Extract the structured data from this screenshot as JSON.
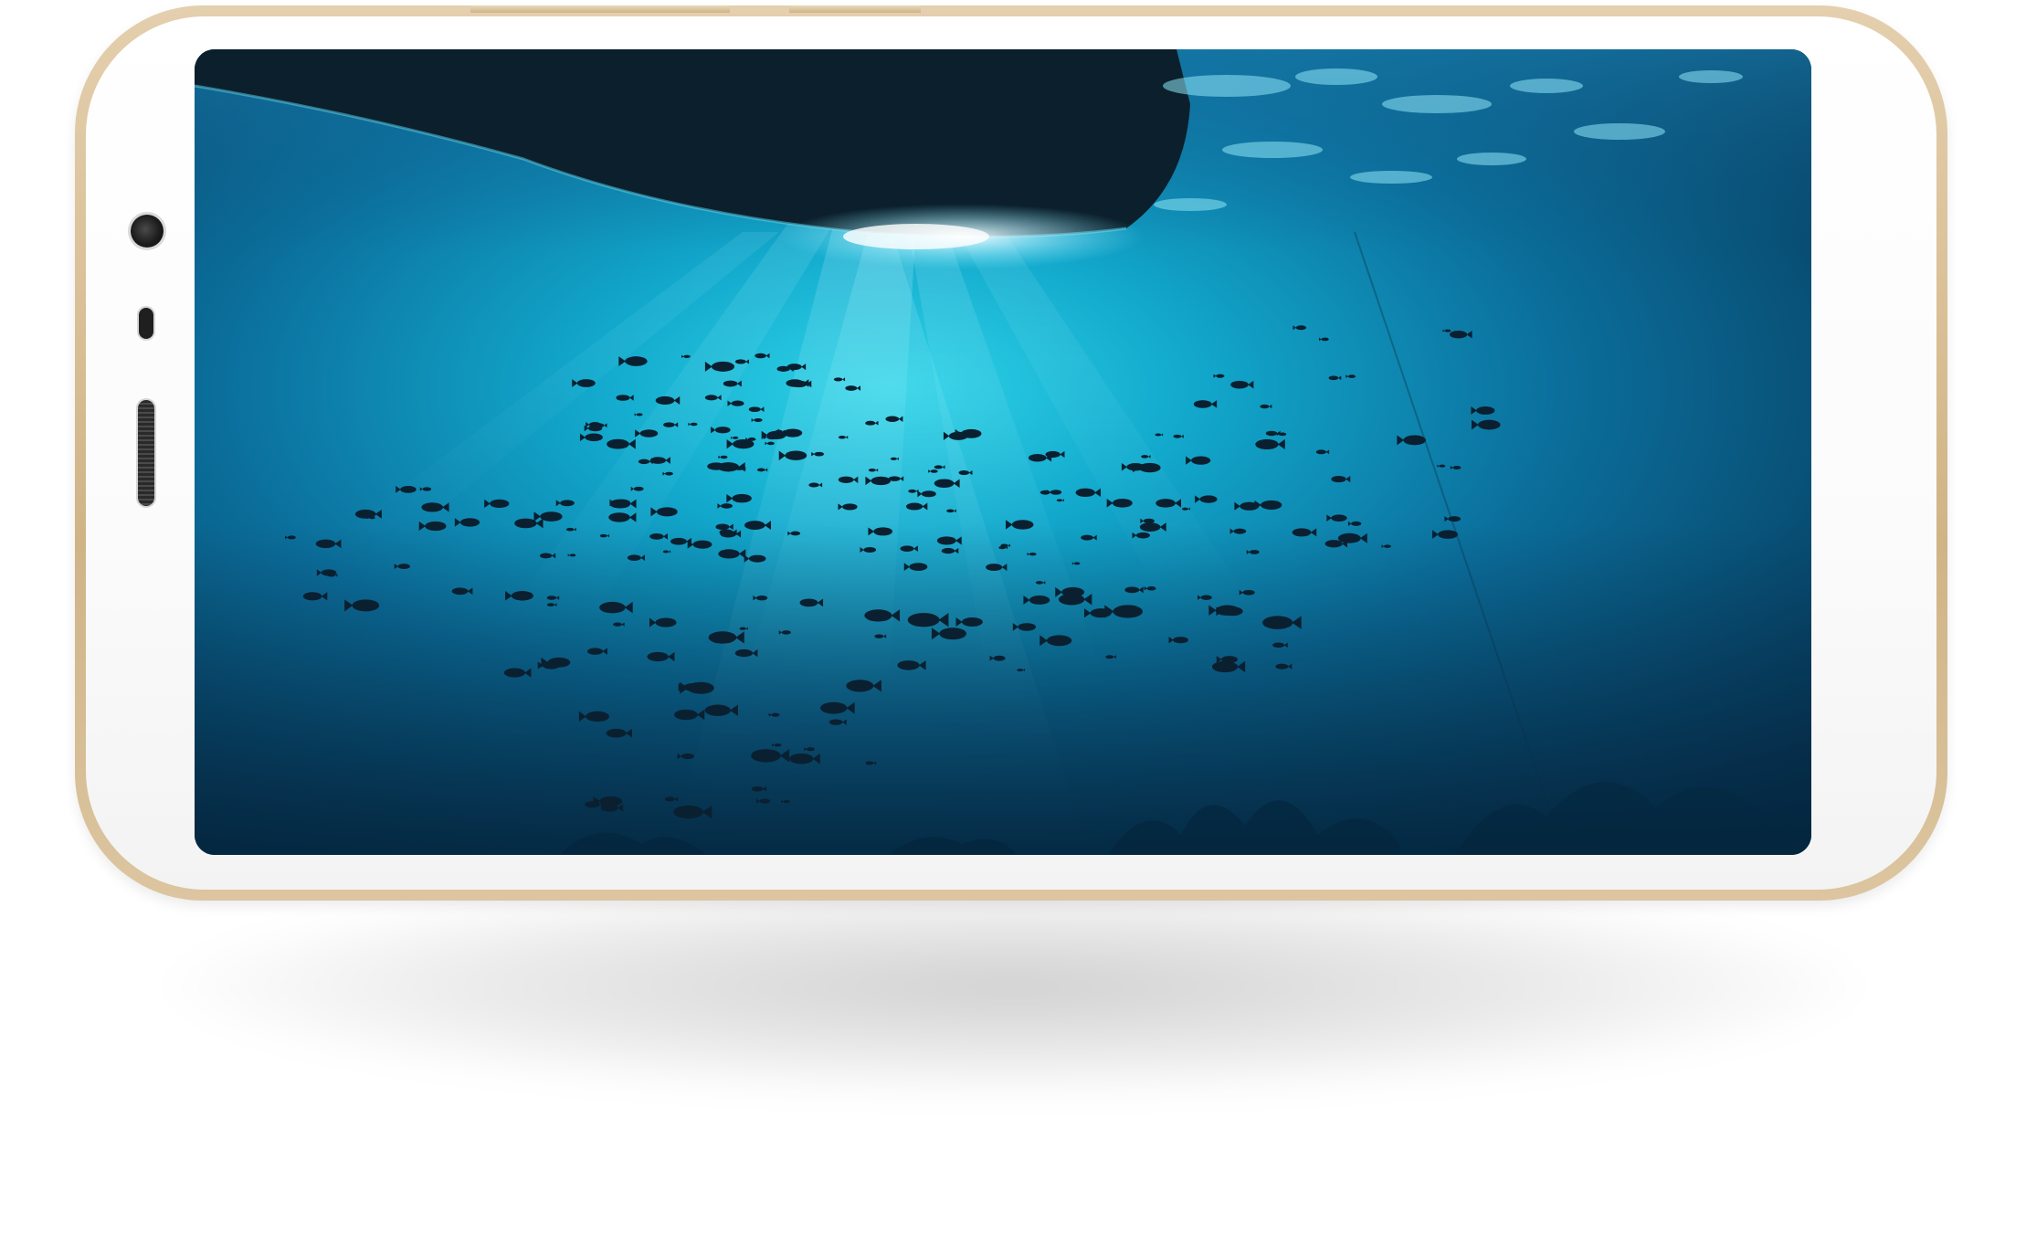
{
  "scene": {
    "subject": "smartphone-landscape",
    "frame_color": "#d9c19a",
    "face_color": "#ffffff",
    "screen_content": "underwater-school-of-fish"
  },
  "colors": {
    "water_light": "#3fd0e6",
    "water_mid": "#1286b0",
    "water_deep": "#063150",
    "hull": "#0b1f2c",
    "fish": "#0a2030"
  }
}
